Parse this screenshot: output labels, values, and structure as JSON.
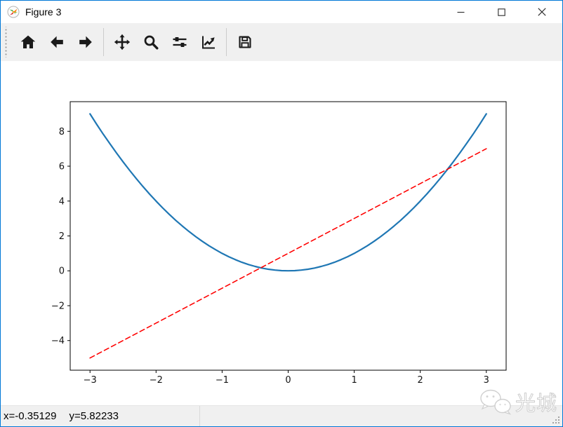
{
  "window": {
    "accent_border_color": "#0078d7"
  },
  "titlebar": {
    "title": "Figure 3",
    "app_icon": "matplotlib-logo-icon",
    "buttons": [
      {
        "name": "minimize-button"
      },
      {
        "name": "maximize-button"
      },
      {
        "name": "close-button"
      }
    ]
  },
  "toolbar": {
    "icons": [
      "home-icon",
      "back-arrow-icon",
      "forward-arrow-icon",
      "pan-icon",
      "zoom-rect-icon",
      "configure-subplots-icon",
      "edit-plot-icon",
      "save-icon"
    ]
  },
  "statusbar": {
    "cursor_x": "x=-0.35129",
    "cursor_y": "y=5.82233"
  },
  "watermark": {
    "icon": "wechat-icon",
    "text": "光城"
  },
  "chart_data": {
    "type": "line",
    "title": "",
    "xlabel": "",
    "ylabel": "",
    "xlim": [
      -3.3,
      3.3
    ],
    "ylim": [
      -5.7,
      9.7
    ],
    "xticks": [
      -3,
      -2,
      -1,
      0,
      1,
      2,
      3
    ],
    "yticks": [
      -4,
      -2,
      0,
      2,
      4,
      6,
      8
    ],
    "grid": false,
    "legend": null,
    "background": "#ffffff",
    "series": [
      {
        "color": "#1f77b4",
        "style": "solid",
        "linewidth": 2.2,
        "x": [
          -3,
          -2.9,
          -2.8,
          -2.7,
          -2.6,
          -2.5,
          -2.4,
          -2.3,
          -2.2,
          -2.1,
          -2,
          -1.9,
          -1.8,
          -1.7,
          -1.6,
          -1.5,
          -1.4,
          -1.3,
          -1.2,
          -1.1,
          -1,
          -0.9,
          -0.8,
          -0.7,
          -0.6,
          -0.5,
          -0.4,
          -0.3,
          -0.2,
          -0.1,
          0,
          0.1,
          0.2,
          0.3,
          0.4,
          0.5,
          0.6,
          0.7,
          0.8,
          0.9,
          1,
          1.1,
          1.2,
          1.3,
          1.4,
          1.5,
          1.6,
          1.7,
          1.8,
          1.9,
          2,
          2.1,
          2.2,
          2.3,
          2.4,
          2.5,
          2.6,
          2.7,
          2.8,
          2.9,
          3
        ],
        "y": [
          9,
          8.41,
          7.84,
          7.29,
          6.76,
          6.25,
          5.76,
          5.29,
          4.84,
          4.41,
          4,
          3.61,
          3.24,
          2.89,
          2.56,
          2.25,
          1.96,
          1.69,
          1.44,
          1.21,
          1,
          0.81,
          0.64,
          0.49,
          0.36,
          0.25,
          0.16,
          0.09,
          0.04,
          0.01,
          0,
          0.01,
          0.04,
          0.09,
          0.16,
          0.25,
          0.36,
          0.49,
          0.64,
          0.81,
          1,
          1.21,
          1.44,
          1.69,
          1.96,
          2.25,
          2.56,
          2.89,
          3.24,
          3.61,
          4,
          4.41,
          4.84,
          5.29,
          5.76,
          6.25,
          6.76,
          7.29,
          7.84,
          8.41,
          9
        ]
      },
      {
        "color": "#ff0000",
        "style": "dashed",
        "linewidth": 1.6,
        "x": [
          -3,
          3
        ],
        "y": [
          -5,
          7
        ]
      }
    ]
  }
}
